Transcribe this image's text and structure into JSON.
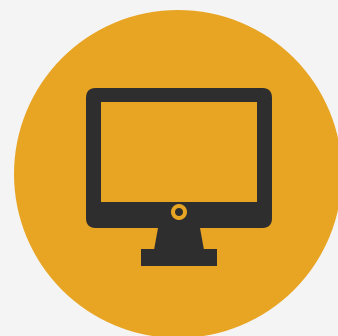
{
  "colors": {
    "background": "#f4f4f4",
    "badge": "#e8a423",
    "icon": "#2e2e2e"
  },
  "icon": {
    "name": "desktop-monitor-icon"
  }
}
